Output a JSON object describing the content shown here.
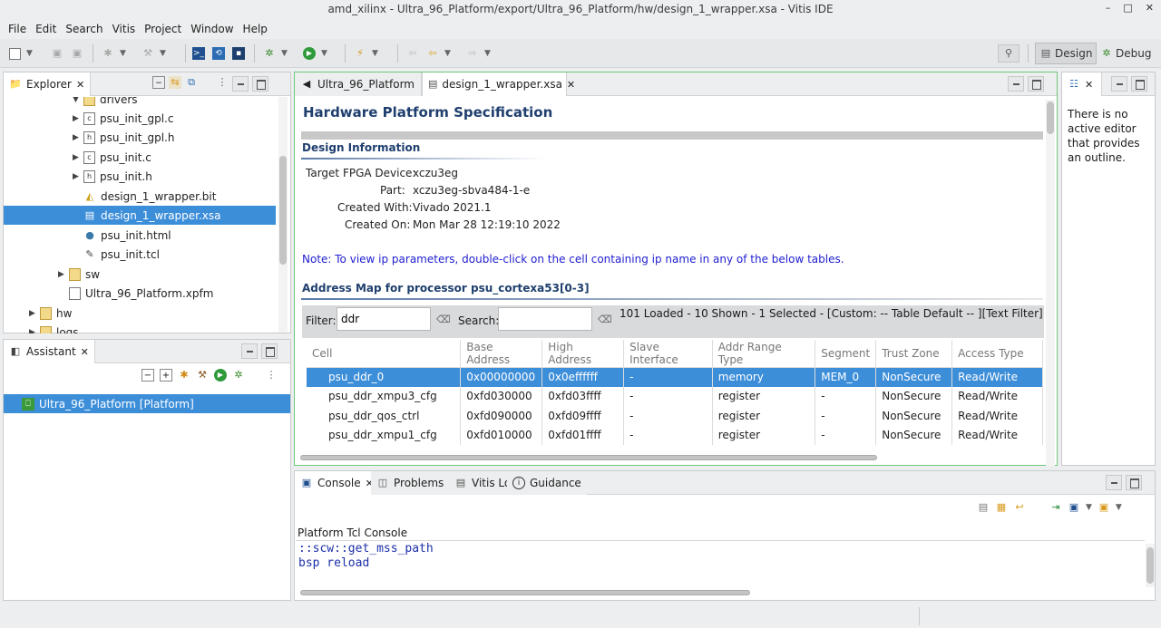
{
  "window": {
    "title": "amd_xilinx - Ultra_96_Platform/export/Ultra_96_Platform/hw/design_1_wrapper.xsa - Vitis IDE",
    "minimize": "–",
    "maximize": "□",
    "close": "✕"
  },
  "menu": [
    "File",
    "Edit",
    "Search",
    "Vitis",
    "Project",
    "Window",
    "Help"
  ],
  "perspectives": {
    "design": "Design",
    "debug": "Debug"
  },
  "explorer": {
    "tab": "Explorer",
    "items": [
      {
        "label": "drivers",
        "type": "folder",
        "expanded": true
      },
      {
        "label": "psu_init_gpl.c",
        "type": "c"
      },
      {
        "label": "psu_init_gpl.h",
        "type": "h"
      },
      {
        "label": "psu_init.c",
        "type": "c"
      },
      {
        "label": "psu_init.h",
        "type": "h"
      },
      {
        "label": "design_1_wrapper.bit",
        "type": "bit"
      },
      {
        "label": "design_1_wrapper.xsa",
        "type": "xsa",
        "selected": true
      },
      {
        "label": "psu_init.html",
        "type": "html"
      },
      {
        "label": "psu_init.tcl",
        "type": "tcl"
      },
      {
        "label": "sw",
        "type": "folder"
      },
      {
        "label": "Ultra_96_Platform.xpfm",
        "type": "xpfm"
      },
      {
        "label": "hw",
        "type": "folder"
      },
      {
        "label": "logs",
        "type": "folder"
      }
    ]
  },
  "assistant": {
    "tab": "Assistant",
    "item": "Ultra_96_Platform [Platform]"
  },
  "editor": {
    "tabs": [
      "Ultra_96_Platform",
      "design_1_wrapper.xsa"
    ],
    "heading": "Hardware Platform Specification",
    "design_info_title": "Design Information",
    "design_info": [
      {
        "key": "Target FPGA Device:",
        "value": "xczu3eg"
      },
      {
        "key": "Part:",
        "value": "xczu3eg-sbva484-1-e"
      },
      {
        "key": "Created With:",
        "value": "Vivado 2021.1"
      },
      {
        "key": "Created On:",
        "value": "Mon Mar 28 12:19:10 2022"
      }
    ],
    "note": "Note: To view ip parameters, double-click on the cell containing ip name in any of the below tables.",
    "address_map_title": "Address Map for processor psu_cortexa53[0-3]",
    "filter_label": "Filter:",
    "filter_value": "ddr",
    "search_label": "Search:",
    "search_value": "",
    "status": "101 Loaded - 10 Shown - 1 Selected -  [Custom: -- Table Default -- ][Text Filter]",
    "columns": [
      "Cell",
      "Base Address",
      "High Address",
      "Slave Interface",
      "Addr Range Type",
      "Segment",
      "Trust Zone",
      "Access Type"
    ],
    "rows": [
      [
        "psu_ddr_0",
        "0x00000000",
        "0x0effffff",
        "-",
        "memory",
        "MEM_0",
        "NonSecure",
        "Read/Write"
      ],
      [
        "psu_ddr_xmpu3_cfg",
        "0xfd030000",
        "0xfd03ffff",
        "-",
        "register",
        "-",
        "NonSecure",
        "Read/Write"
      ],
      [
        "psu_ddr_qos_ctrl",
        "0xfd090000",
        "0xfd09ffff",
        "-",
        "register",
        "-",
        "NonSecure",
        "Read/Write"
      ],
      [
        "psu_ddr_xmpu1_cfg",
        "0xfd010000",
        "0xfd01ffff",
        "-",
        "register",
        "-",
        "NonSecure",
        "Read/Write"
      ]
    ]
  },
  "outline": {
    "message": "There is no active editor that provides an outline."
  },
  "console": {
    "tabs": [
      "Console",
      "Problems",
      "Vitis Log",
      "Guidance"
    ],
    "title": "Platform Tcl Console",
    "lines": [
      "::scw::get_mss_path",
      "bsp reload"
    ]
  }
}
